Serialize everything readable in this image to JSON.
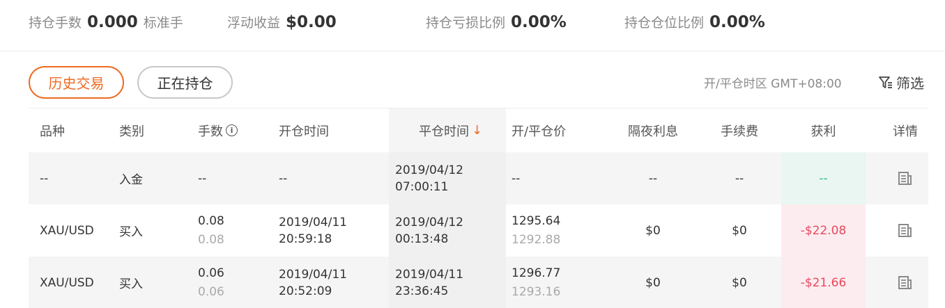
{
  "summary": {
    "lots_label": "持仓手数",
    "lots_value": "0.000",
    "lots_unit": "标准手",
    "floating_label": "浮动收益",
    "floating_value": "$0.00",
    "loss_ratio_label": "持仓亏损比例",
    "loss_ratio_value": "0.00%",
    "position_ratio_label": "持仓仓位比例",
    "position_ratio_value": "0.00%"
  },
  "tabs": {
    "history": "历史交易",
    "open": "正在持仓"
  },
  "timezone": "开/平仓时区 GMT+08:00",
  "filter_label": "筛选",
  "columns": {
    "symbol": "品种",
    "type": "类别",
    "lots": "手数",
    "open_time": "开仓时间",
    "close_time": "平仓时间",
    "price": "开/平仓价",
    "swap": "隔夜利息",
    "fee": "手续费",
    "profit": "获利",
    "detail": "详情"
  },
  "rows": [
    {
      "symbol": "--",
      "type": "入金",
      "lots": "--",
      "lots_sub": "",
      "open_date": "--",
      "open_clock": "",
      "close_date": "2019/04/12",
      "close_clock": "07:00:11",
      "price_open": "--",
      "price_close": "",
      "swap": "--",
      "fee": "--",
      "profit": "--"
    },
    {
      "symbol": "XAU/USD",
      "type": "买入",
      "lots": "0.08",
      "lots_sub": "0.08",
      "open_date": "2019/04/11",
      "open_clock": "20:59:18",
      "close_date": "2019/04/12",
      "close_clock": "00:13:48",
      "price_open": "1295.64",
      "price_close": "1292.88",
      "swap": "$0",
      "fee": "$0",
      "profit": "-$22.08"
    },
    {
      "symbol": "XAU/USD",
      "type": "买入",
      "lots": "0.06",
      "lots_sub": "0.06",
      "open_date": "2019/04/11",
      "open_clock": "20:52:09",
      "close_date": "2019/04/11",
      "close_clock": "23:36:45",
      "price_open": "1296.77",
      "price_close": "1293.16",
      "swap": "$0",
      "fee": "$0",
      "profit": "-$21.66"
    }
  ],
  "colors": {
    "accent": "#f06a22",
    "profit_positive": "#3ab58a",
    "profit_negative": "#e8495e"
  },
  "icons": {
    "info": "info-icon",
    "filter": "filter-icon",
    "detail": "document-icon",
    "sort": "arrow-down-icon"
  }
}
